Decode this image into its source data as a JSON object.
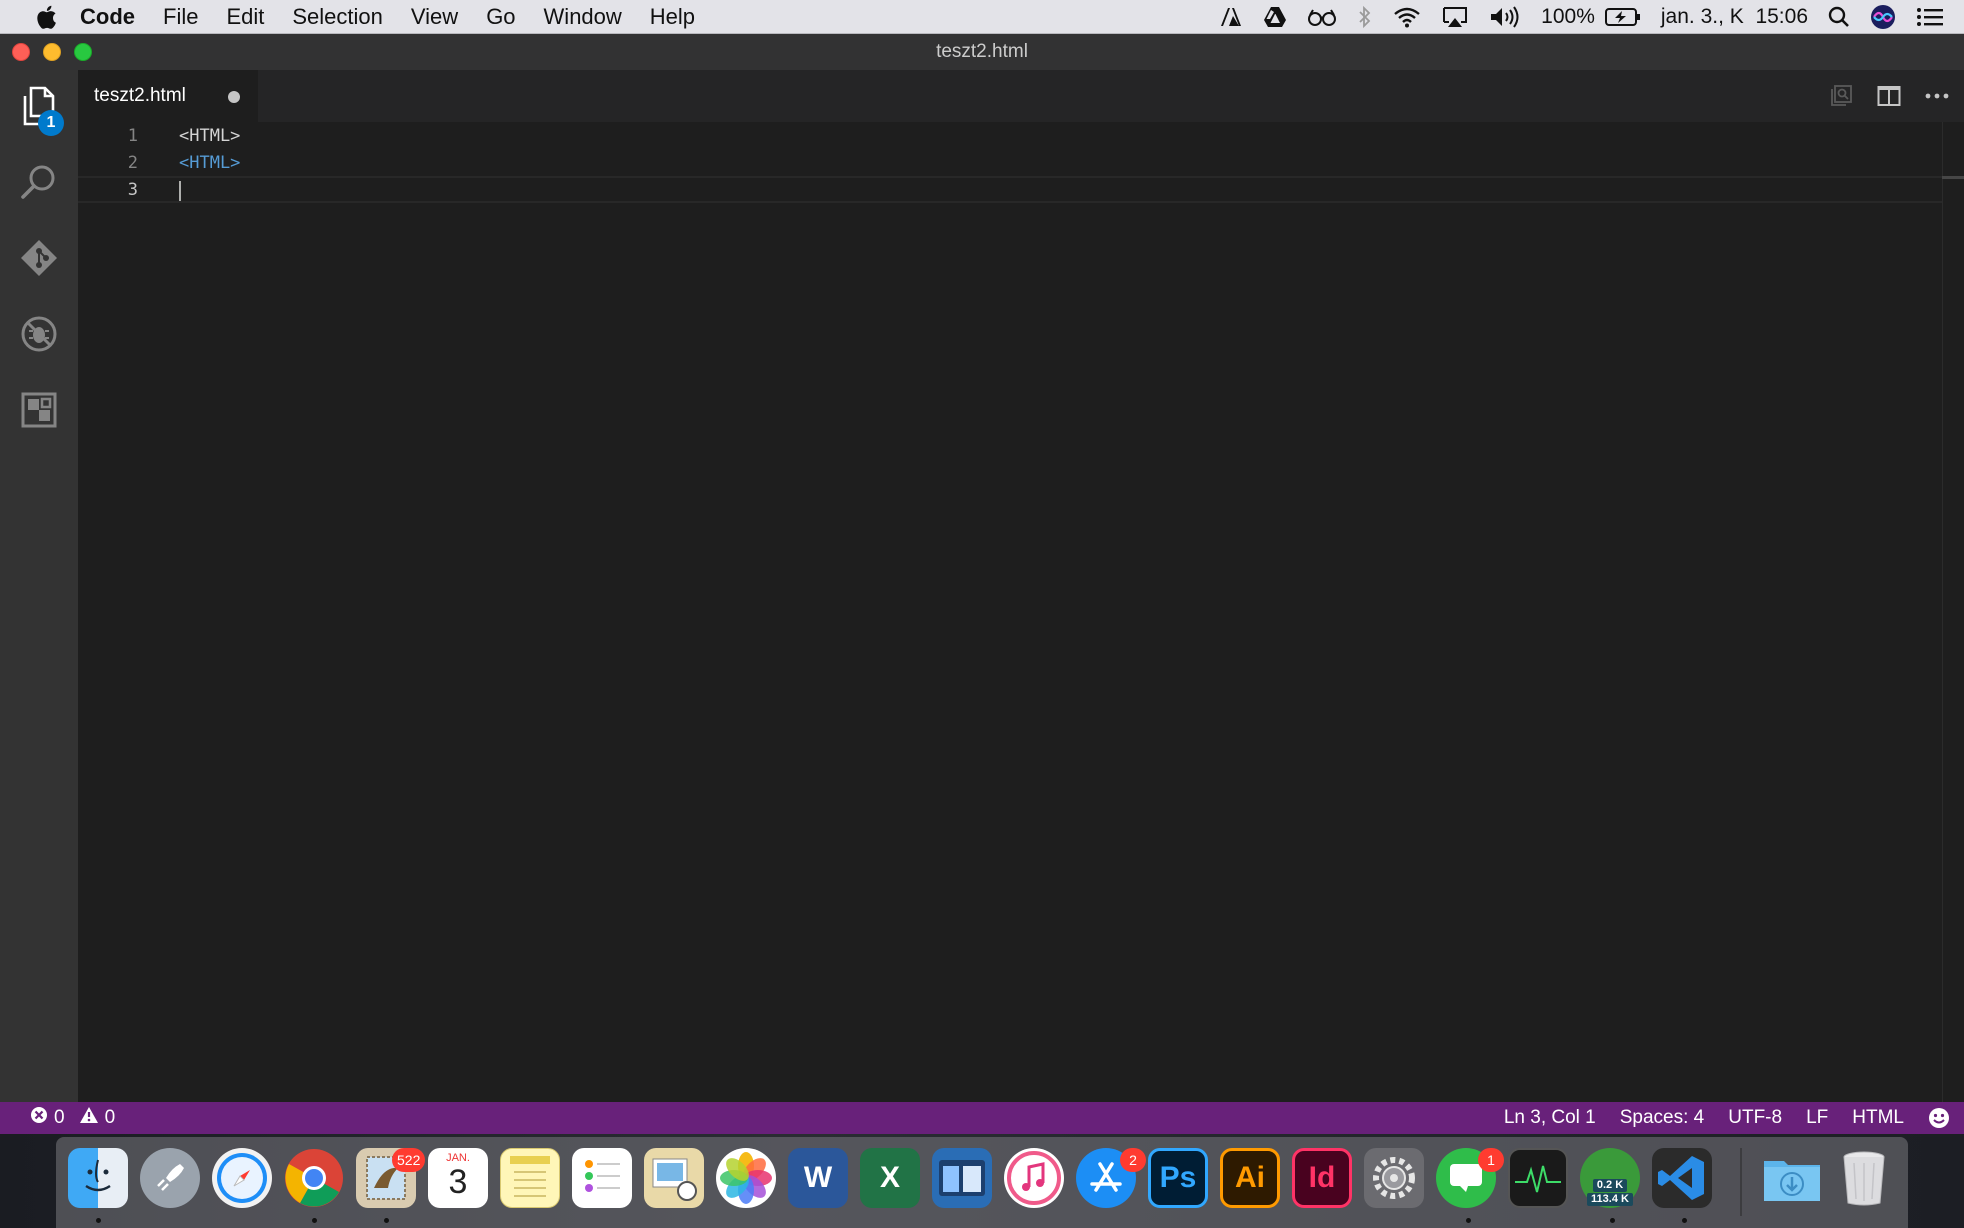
{
  "menubar": {
    "app_name": "Code",
    "items": [
      "File",
      "Edit",
      "Selection",
      "View",
      "Go",
      "Window",
      "Help"
    ],
    "battery": "100%",
    "clock": "jan. 3., K  15:06"
  },
  "window": {
    "title": "teszt2.html"
  },
  "activity": {
    "explorer_badge": "1"
  },
  "tab": {
    "label": "teszt2.html"
  },
  "editor": {
    "lines": [
      {
        "number": "1",
        "text": "<HTML>"
      },
      {
        "number": "2",
        "text": "<HTML>"
      },
      {
        "number": "3",
        "text": ""
      }
    ]
  },
  "statusbar": {
    "errors": "0",
    "warnings": "0",
    "position": "Ln 3, Col 1",
    "spaces": "Spaces: 4",
    "encoding": "UTF-8",
    "eol": "LF",
    "language": "HTML"
  },
  "dock": {
    "mail_badge": "522",
    "calendar_month": "JAN.",
    "calendar_day": "3",
    "appstore_badge": "2",
    "messages_badge": "1",
    "photoshop_label": "Ps",
    "illustrator_label": "Ai",
    "indesign_label": "Id",
    "word_label": "W",
    "excel_label": "X",
    "net_up": "0.2 K",
    "net_down": "113.4 K"
  },
  "colors": {
    "statusbar": "#68217a",
    "accent": "#007acc",
    "editor_bg": "#1e1e1e",
    "tag": "#569cd6"
  }
}
